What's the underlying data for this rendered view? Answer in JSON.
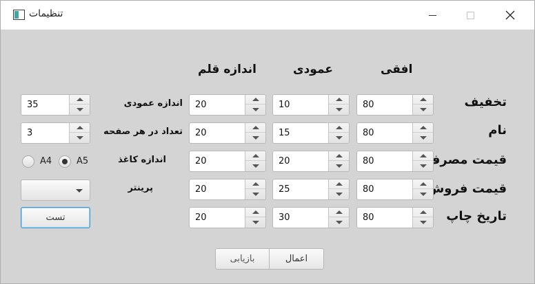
{
  "window": {
    "title": "تنظیمات"
  },
  "headers": {
    "horizontal": "افقی",
    "vertical": "عمودی",
    "font_size": "اندازه قلم"
  },
  "rows": [
    {
      "label": "تخفیف",
      "horizontal": "80",
      "vertical": "10",
      "font_size": "20"
    },
    {
      "label": "نام",
      "horizontal": "80",
      "vertical": "15",
      "font_size": "20"
    },
    {
      "label": "قیمت مصرف",
      "horizontal": "80",
      "vertical": "20",
      "font_size": "20"
    },
    {
      "label": "قیمت فروش",
      "horizontal": "80",
      "vertical": "25",
      "font_size": "20"
    },
    {
      "label": "تاریخ چاپ",
      "horizontal": "80",
      "vertical": "30",
      "font_size": "20"
    }
  ],
  "settings": {
    "vertical_size_label": "اندازه عمودی",
    "vertical_size_value": "35",
    "per_page_label": "تعداد در هر صفحه",
    "per_page_value": "3",
    "paper_size_label": "اندازه کاغذ",
    "paper_options": [
      "A4",
      "A5"
    ],
    "paper_selected": "A5",
    "printer_label": "پرینتر",
    "printer_value": ""
  },
  "buttons": {
    "test": "تست",
    "reset": "بازیابی",
    "apply": "اعمال"
  }
}
